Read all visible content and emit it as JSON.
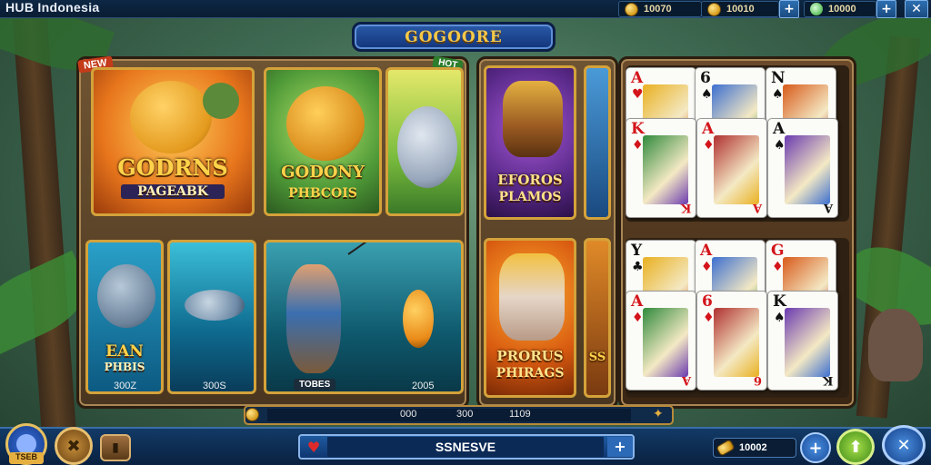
{
  "header": {
    "brand": "HUB Indonesia",
    "coins_1": "10070",
    "coins_2": "10010",
    "gems": "10000",
    "plus": "+",
    "close": "✕"
  },
  "banner": {
    "title": "GOGOORE"
  },
  "left_panel": {
    "corner_tag": "NEW",
    "corner_tag_2": "HOT",
    "top_cards": [
      {
        "title": "GODRNS",
        "subtitle": "PAGEABK"
      },
      {
        "title": "GODONY",
        "subtitle": "PHBCOIS"
      },
      {
        "title": "",
        "subtitle": ""
      }
    ],
    "bottom_cards": [
      {
        "title": "EAN",
        "subtitle": "PHBIS",
        "value": "300Z"
      },
      {
        "title": "",
        "subtitle": "",
        "value": "300S"
      },
      {
        "title": "",
        "subtitle": "",
        "value": "2005",
        "tag": "TOBES"
      }
    ]
  },
  "middle_panel": {
    "top_card": {
      "title": "EFOROS",
      "subtitle": "PLAMOS"
    },
    "bottom_card": {
      "title": "PRORUS",
      "subtitle": "PHIRAGS"
    },
    "strip_bottom": "SS"
  },
  "cards_top": [
    {
      "rank": "A",
      "suit": "♥",
      "color": "red"
    },
    {
      "rank": "6",
      "suit": "♠",
      "color": "blk"
    },
    {
      "rank": "N",
      "suit": "♠",
      "color": "blk"
    },
    {
      "rank": "K",
      "suit": "♦",
      "color": "red"
    },
    {
      "rank": "A",
      "suit": "♦",
      "color": "red"
    },
    {
      "rank": "A",
      "suit": "♠",
      "color": "blk"
    }
  ],
  "cards_bottom": [
    {
      "rank": "Y",
      "suit": "♣",
      "color": "blk"
    },
    {
      "rank": "A",
      "suit": "♦",
      "color": "red"
    },
    {
      "rank": "G",
      "suit": "♦",
      "color": "red"
    },
    {
      "rank": "A",
      "suit": "♦",
      "color": "red"
    },
    {
      "rank": "6",
      "suit": "♦",
      "color": "red"
    },
    {
      "rank": "K",
      "suit": "♠",
      "color": "blk"
    }
  ],
  "progress": {
    "values": [
      "000",
      "300",
      "1109"
    ]
  },
  "bottom": {
    "left_badge": "TSEB",
    "center_label": "SSNESVE",
    "center_plus": "+",
    "balance": "10002",
    "plus": "+"
  }
}
